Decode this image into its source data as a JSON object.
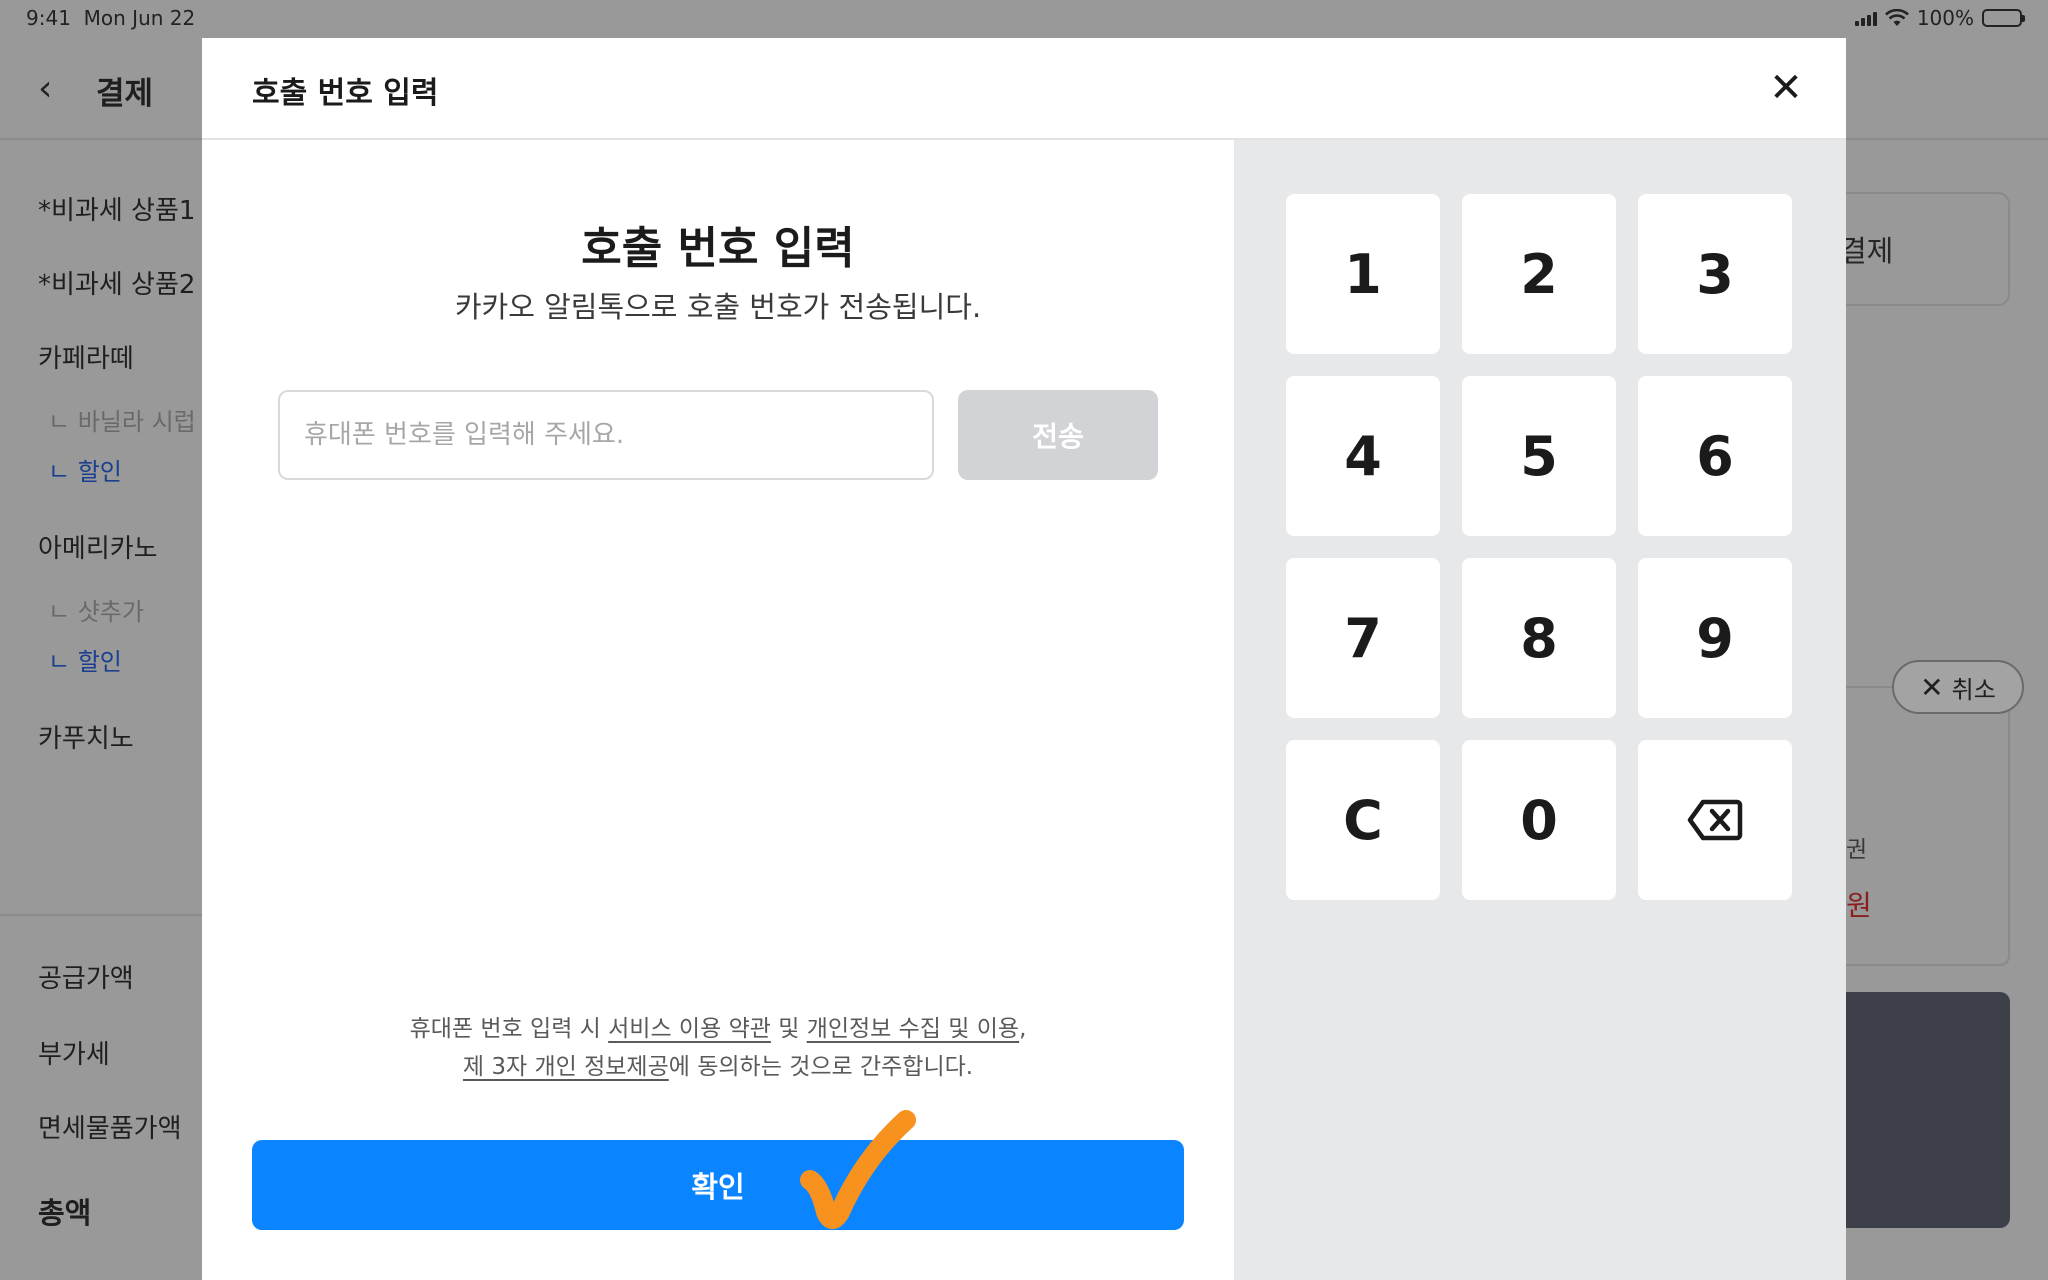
{
  "status_bar": {
    "time": "9:41",
    "date": "Mon Jun 22",
    "battery": "100%"
  },
  "background": {
    "header_title": "결제",
    "items": [
      {
        "name": "*비과세 상품1"
      },
      {
        "name": "*비과세 상품2"
      },
      {
        "name": "카페라떼",
        "subs": [
          {
            "label": "ㄴ 바닐라 시럽",
            "kind": "option"
          },
          {
            "label": "ㄴ 할인",
            "kind": "discount"
          }
        ]
      },
      {
        "name": "아메리카노",
        "subs": [
          {
            "label": "ㄴ 샷추가",
            "kind": "option"
          },
          {
            "label": "ㄴ 할인",
            "kind": "discount"
          }
        ]
      },
      {
        "name": "카푸치노"
      }
    ],
    "summary": [
      "공급가액",
      "부가세",
      "면세물품가액",
      "총액"
    ],
    "right_card_label": "결제",
    "cancel_label": "취소",
    "coupon_label": "권",
    "won_label": "원"
  },
  "modal": {
    "title": "호출 번호 입력",
    "heading": "호출 번호 입력",
    "subtitle": "카카오 알림톡으로 호출 번호가 전송됩니다.",
    "phone_placeholder": "휴대폰 번호를 입력해 주세요.",
    "phone_value": "",
    "send_label": "전송",
    "terms": {
      "prefix": "휴대폰 번호 입력 시 ",
      "link_service": "서비스 이용 약관",
      "and": " 및 ",
      "link_privacy": "개인정보 수집 및 이용",
      "comma": ",",
      "link_third": "제 3자 개인 정보제공",
      "suffix": "에  동의하는 것으로 간주합니다."
    },
    "confirm_label": "확인"
  },
  "keypad": {
    "keys": [
      "1",
      "2",
      "3",
      "4",
      "5",
      "6",
      "7",
      "8",
      "9",
      "C",
      "0",
      "backspace-icon"
    ]
  },
  "colors": {
    "primary": "#0a84ff",
    "send_disabled": "#d2d3d6",
    "keypad_bg": "#e7e8ea",
    "annotation_check": "#f7921e",
    "discount_text": "#1a3f8f"
  }
}
